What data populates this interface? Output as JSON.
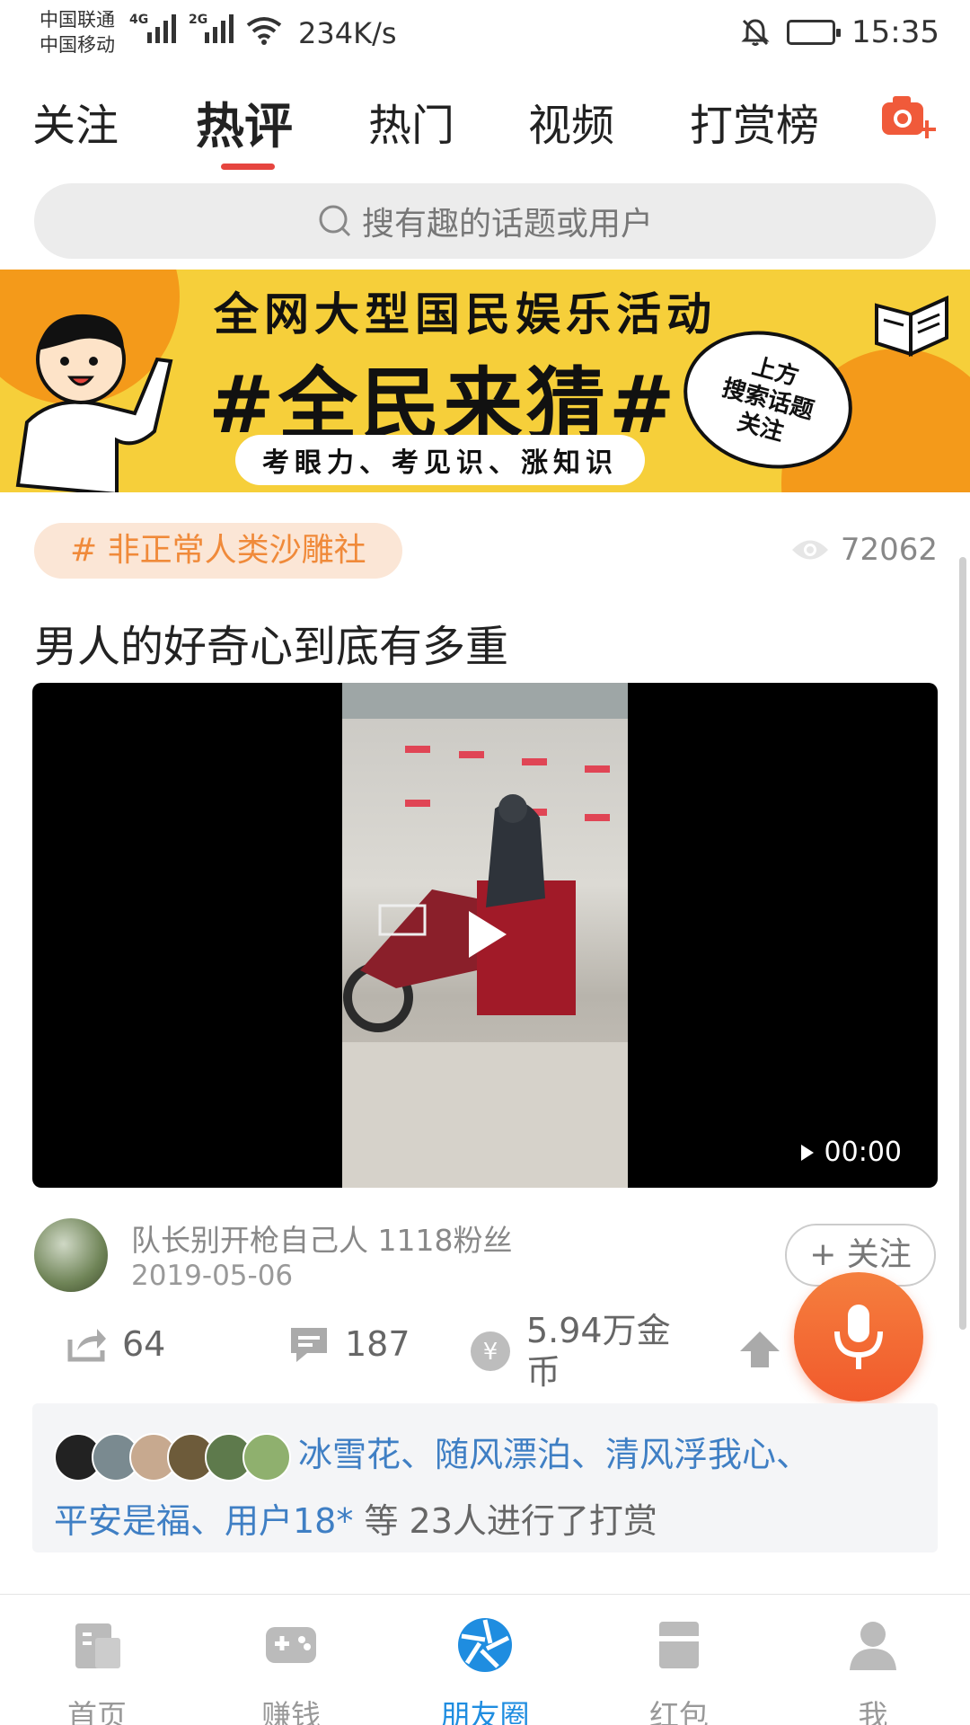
{
  "status_bar": {
    "carrier1": "中国联通",
    "carrier2": "中国移动",
    "net1": "4G",
    "net2": "2G",
    "net_speed": "234K/s",
    "time": "15:35"
  },
  "tabs": [
    {
      "label": "关注"
    },
    {
      "label": "热评"
    },
    {
      "label": "热门"
    },
    {
      "label": "视频"
    },
    {
      "label": "打赏榜"
    }
  ],
  "search": {
    "placeholder": "搜有趣的话题或用户"
  },
  "banner": {
    "title": "全网大型国民娱乐活动",
    "headline": "#全民来猜#",
    "subtitle": "考眼力、考见识、涨知识",
    "bubble_line1": "上方",
    "bubble_line2": "搜索话题",
    "bubble_line3": "关注"
  },
  "post": {
    "topic": "# 非正常人类沙雕社",
    "views": "72062",
    "title": "男人的好奇心到底有多重",
    "video_time": "00:00",
    "author_line": "队长别开枪自己人 1118粉丝",
    "date": "2019-05-06",
    "follow_label": "+ 关注",
    "shares": "64",
    "comments": "187",
    "reward": "5.94万金币"
  },
  "rewarders": {
    "names_line1": "冰雪花、随风漂泊、清风浮我心、",
    "names_line2": "平安是福、用户18*",
    "suffix": " 等 23人进行了打赏"
  },
  "bottom_nav": [
    {
      "label": "首页"
    },
    {
      "label": "赚钱"
    },
    {
      "label": "朋友圈"
    },
    {
      "label": "红包"
    },
    {
      "label": "我"
    }
  ],
  "colors": {
    "accent_red": "#e6453f",
    "topic_orange": "#f08a3a",
    "link_blue": "#3f7fc4",
    "nav_active": "#1f8de0",
    "fab_orange": "#f15a2c"
  }
}
